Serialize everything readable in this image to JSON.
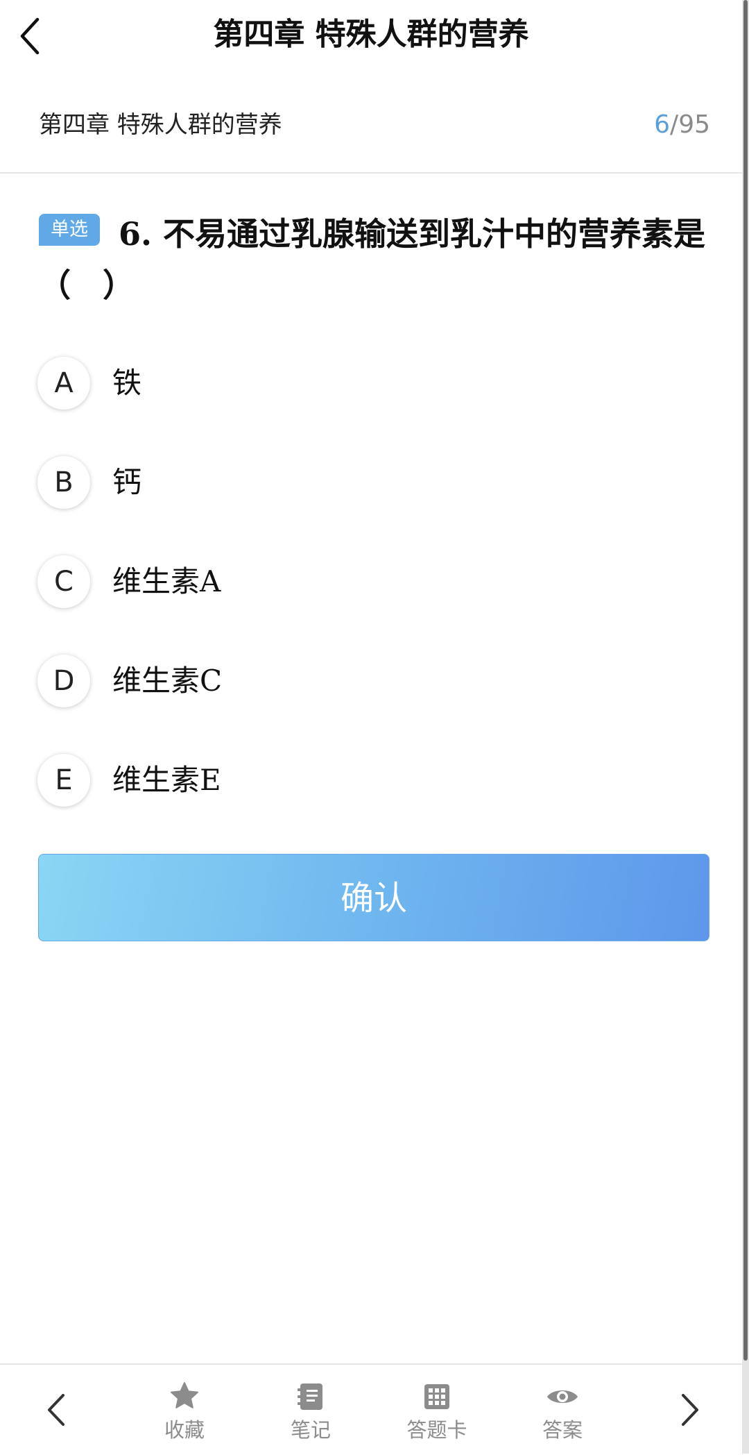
{
  "header": {
    "title": "第四章 特殊人群的营养",
    "back_icon": "chevron-left-icon"
  },
  "chapter": {
    "name": "第四章 特殊人群的营养",
    "current": "6",
    "separator": "/",
    "total": "95"
  },
  "question": {
    "type_badge": "单选",
    "text": "6. 不易通过乳腺输送到乳汁中的营养素是（　）"
  },
  "options": [
    {
      "letter": "A",
      "text": "铁"
    },
    {
      "letter": "B",
      "text": "钙"
    },
    {
      "letter": "C",
      "text": "维生素A"
    },
    {
      "letter": "D",
      "text": "维生素C"
    },
    {
      "letter": "E",
      "text": "维生素E"
    }
  ],
  "confirm_label": "确认",
  "toolbar": {
    "favorite": "收藏",
    "note": "笔记",
    "answer_card": "答题卡",
    "answer": "答案"
  },
  "colors": {
    "accent": "#61a9e6",
    "progress_current": "#5a9fd8",
    "button_start": "#8ad6f4",
    "button_end": "#5e97ea"
  }
}
